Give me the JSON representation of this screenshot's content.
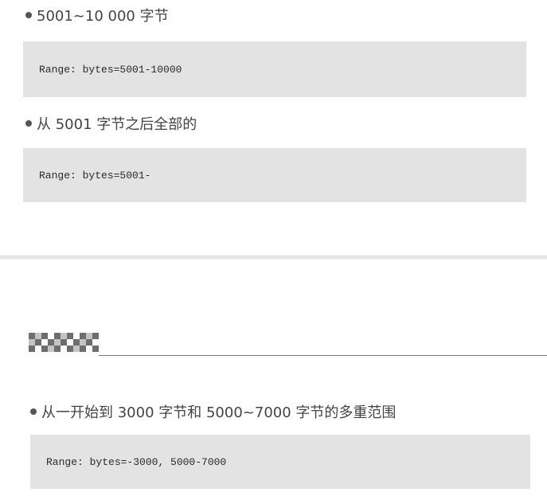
{
  "items": [
    {
      "text": "5001~10 000 字节",
      "code": "Range: bytes=5001-10000"
    },
    {
      "text": "从 5001 字节之后全部的",
      "code": "Range: bytes=5001-"
    },
    {
      "text": "从一开始到 3000 字节和 5000~7000 字节的多重范围",
      "code": "Range: bytes=-3000, 5000-7000"
    }
  ]
}
